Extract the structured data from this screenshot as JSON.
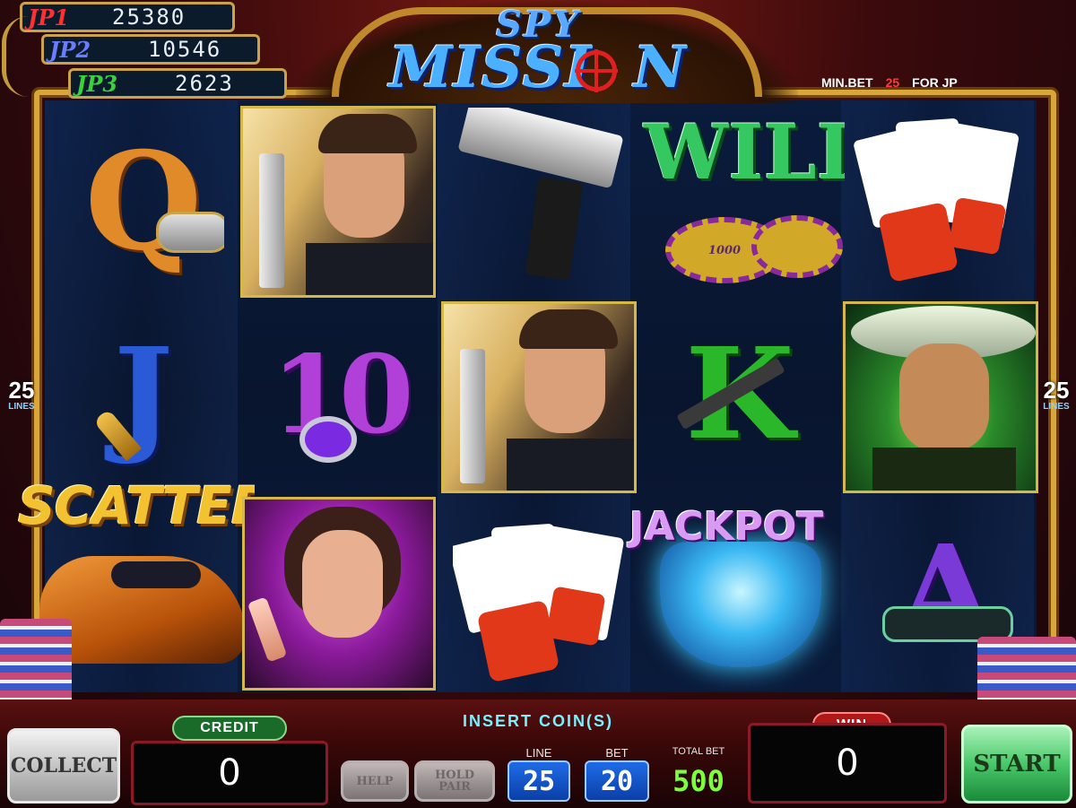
{
  "jackpots": [
    {
      "label": "JP1",
      "value": "25380",
      "color": "#ff3030"
    },
    {
      "label": "JP2",
      "value": "10546",
      "color": "#6a7cff"
    },
    {
      "label": "JP3",
      "value": "2623",
      "color": "#3ad040"
    }
  ],
  "title": {
    "line1": "SPY",
    "line2": "MISSI",
    "line3": "N"
  },
  "min_bet": {
    "label": "MIN.BET",
    "value": "25",
    "suffix": "FOR JP"
  },
  "lines_badge": {
    "value": "25",
    "label": "LINES"
  },
  "symbols": {
    "q": "Q",
    "j": "J",
    "ten": "10",
    "k": "K",
    "a": "A",
    "wild": "WILD",
    "chip_value": "1000",
    "scatter": "SCATTER",
    "jackpot": "JACKPOT"
  },
  "insert_coin": "INSERT COIN(S)",
  "buttons": {
    "collect": "COLLECT",
    "help": "HELP",
    "hold_pair": "HOLD PAIR",
    "start": "START"
  },
  "credit": {
    "label": "CREDIT",
    "value": "0"
  },
  "win": {
    "label": "WIN",
    "value": "0"
  },
  "line": {
    "label": "LINE",
    "value": "25"
  },
  "bet": {
    "label": "BET",
    "value": "20"
  },
  "total_bet": {
    "label": "TOTAL BET",
    "value": "500"
  },
  "colors": {
    "gold": "#d9a63a",
    "credit_tag": "#1a7a2a",
    "win_tag": "#b01818",
    "start_green": "#59d67a",
    "total_bet": "#7cff3a"
  }
}
